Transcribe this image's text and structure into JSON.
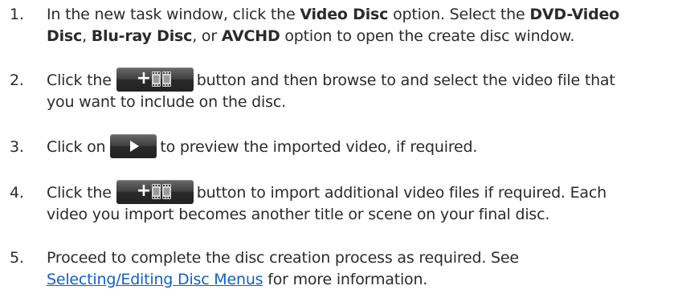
{
  "steps": [
    {
      "number": "1.",
      "l1_a": "In the new task window, click the ",
      "l1_b": "Video Disc",
      "l1_c": " option. Select the ",
      "l1_d": "DVD-Video",
      "l2_a": "Disc",
      "l2_b": ", ",
      "l2_c": "Blu-ray Disc",
      "l2_d": ", or ",
      "l2_e": "AVCHD",
      "l2_f": " option to open the create disc window."
    },
    {
      "number": "2.",
      "l1_a": "Click the",
      "l1_b": "button and then browse to and select the video file that",
      "l2": "you want to include on the disc."
    },
    {
      "number": "3.",
      "l1_a": "Click on",
      "l1_b": "to preview the imported video, if required."
    },
    {
      "number": "4.",
      "l1_a": "Click the",
      "l1_b": "button to import additional video files if required. Each",
      "l2": "video you import becomes another title or scene on your final disc."
    },
    {
      "number": "5.",
      "l1": "Proceed to complete the disc creation process as required. See",
      "l2_link": "Selecting/Editing Disc Menus",
      "l2_rest": " for more information."
    }
  ],
  "icons": {
    "import_button": "add-video-icon",
    "play_button": "play-icon"
  },
  "colors": {
    "text": "#2b2b2b",
    "link": "#1060c8",
    "button_bg": "#333333"
  }
}
